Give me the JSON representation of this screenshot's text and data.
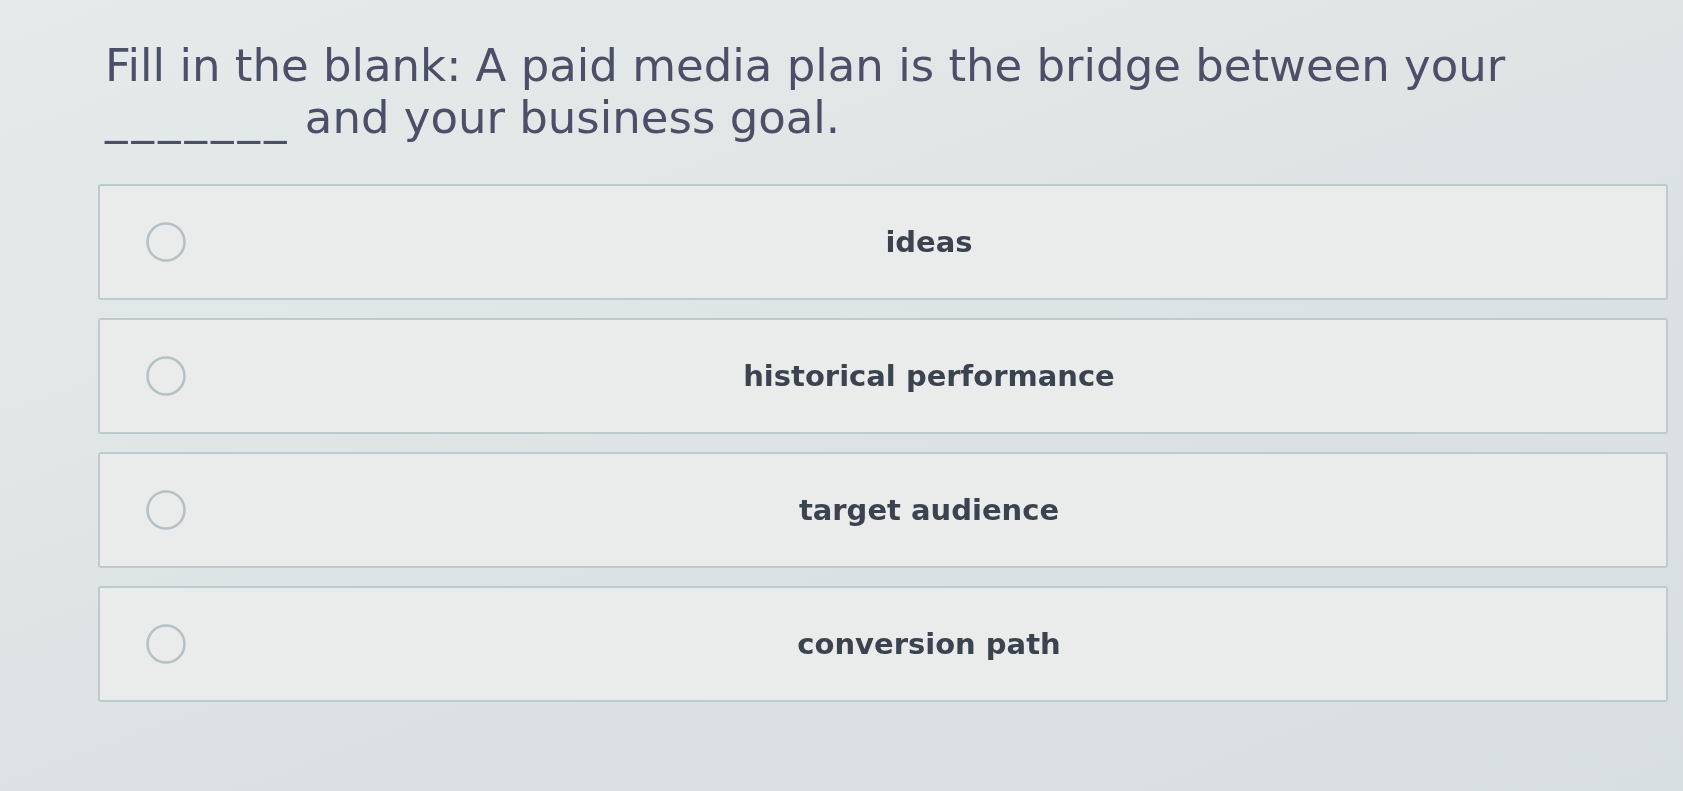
{
  "question": {
    "before": "Fill in the blank: A paid media plan is the bridge between your",
    "blank": "_______",
    "after": "and your business goal."
  },
  "options": [
    {
      "label": "ideas",
      "selected": false
    },
    {
      "label": "historical performance",
      "selected": false
    },
    {
      "label": "target audience",
      "selected": false
    },
    {
      "label": "conversion path",
      "selected": false
    }
  ]
}
